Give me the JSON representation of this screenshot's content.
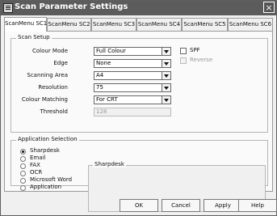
{
  "window": {
    "title": "Scan Parameter Settings",
    "close_symbol": "×",
    "colors": {
      "titlebar": "#5c5c5c",
      "panel": "#fafafa"
    }
  },
  "tabs": [
    "ScanMenu SC1",
    "ScanMenu SC2",
    "ScanMenu SC3",
    "ScanMenu SC4",
    "ScanMenu SC5",
    "ScanMenu SC6"
  ],
  "scan_setup": {
    "title": "Scan Setup",
    "labels": {
      "colour_mode": "Colour Mode",
      "edge": "Edge",
      "scanning_area": "Scanning Area",
      "resolution": "Resolution",
      "colour_matching": "Colour Matching",
      "threshold": "Threshold"
    },
    "values": {
      "colour_mode": "Full Colour",
      "edge": "None",
      "scanning_area": "A4",
      "resolution": "75",
      "colour_matching": "For CRT",
      "threshold": "128"
    },
    "checkboxes": {
      "spf": "SPF",
      "reverse": "Reverse"
    }
  },
  "application_selection": {
    "title": "Application Selection",
    "options": [
      "Sharpdesk",
      "Email",
      "FAX",
      "OCR",
      "Microsoft Word",
      "Application"
    ],
    "preview_title": "Sharpdesk"
  },
  "buttons": {
    "ok": "OK",
    "cancel": "Cancel",
    "apply": "Apply",
    "help": "Help"
  }
}
